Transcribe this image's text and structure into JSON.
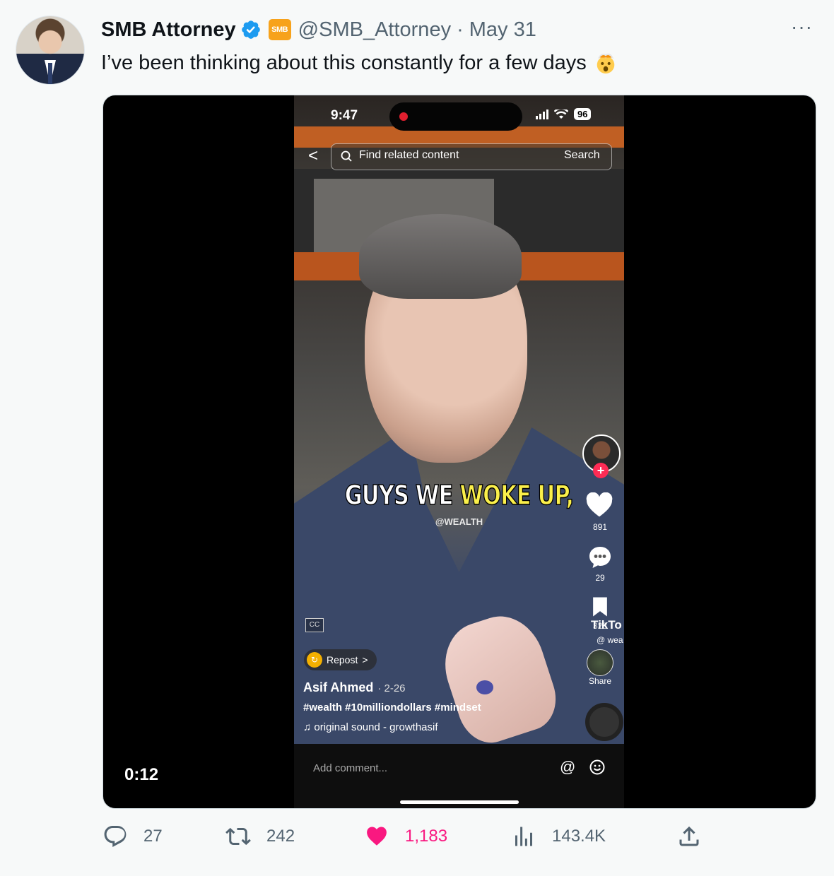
{
  "tweet": {
    "display_name": "SMB Attorney",
    "badge_label": "SMB",
    "handle": "@SMB_Attorney",
    "separator": "·",
    "date": "May 31",
    "more": "···",
    "text": "I’ve been thinking about this constantly for a few days"
  },
  "video": {
    "status_time": "9:47",
    "battery": "96",
    "back": "<",
    "search_placeholder": "Find related content",
    "search_button": "Search",
    "caption_white": "GUYS WE ",
    "caption_yellow": "WOKE UP,",
    "caption_tag": "@WEALTH",
    "likes": "891",
    "comments": "29",
    "bookmarks": "328",
    "watermark": "TikTo",
    "watermark_handle": "@ wea",
    "share_label": "Share",
    "cc": "CC",
    "repost_label": "Repost",
    "repost_chevron": ">",
    "author": "Asif Ahmed",
    "post_date": "· 2-26",
    "hashtags": "#wealth #10milliondollars #mindset",
    "sound": "♫ original sound - growthasif",
    "comment_placeholder": "Add comment...",
    "at_symbol": "@",
    "timer": "0:12"
  },
  "stats": {
    "replies": "27",
    "retweets": "242",
    "likes": "1,183",
    "views": "143.4K"
  },
  "colors": {
    "verified_blue": "#1d9bf0",
    "like_pink": "#f91880",
    "muted": "#536471",
    "badge_orange": "#f7a21b",
    "tiktok_red": "#fe2c55",
    "caption_yellow": "#fbf04a"
  }
}
